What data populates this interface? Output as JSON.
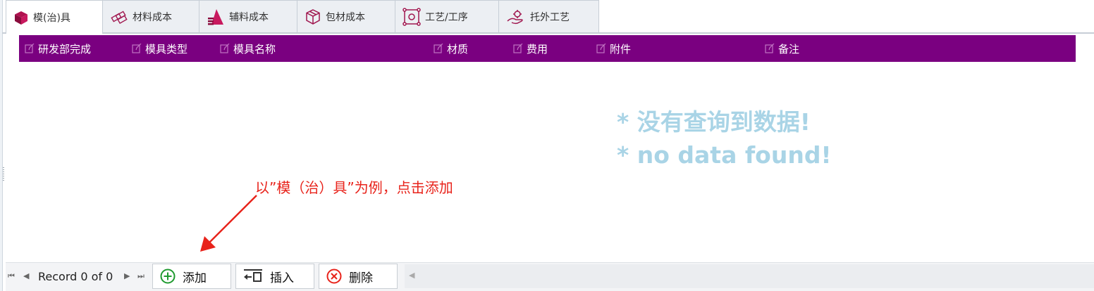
{
  "tabs": [
    {
      "label": "模(治)具",
      "icon": "cube-icon",
      "active": true
    },
    {
      "label": "材料成本",
      "icon": "materials-icon",
      "active": false
    },
    {
      "label": "辅料成本",
      "icon": "auxiliary-icon",
      "active": false
    },
    {
      "label": "包材成本",
      "icon": "package-icon",
      "active": false
    },
    {
      "label": "工艺/工序",
      "icon": "process-icon",
      "active": false
    },
    {
      "label": "托外工艺",
      "icon": "outsource-icon",
      "active": false
    }
  ],
  "grid": {
    "header_color": "#7a0080",
    "columns": [
      "研发部完成",
      "模具类型",
      "模具名称",
      "材质",
      "费用",
      "附件",
      "备注"
    ]
  },
  "empty_state": {
    "line_cn": "* 没有查询到数据!",
    "line_en": "* no data found!"
  },
  "annotation": {
    "text": "以”模（治）具”为例，点击添加",
    "color": "#e8231b"
  },
  "navigator": {
    "record_text": "Record 0 of 0",
    "add_label": "添加",
    "insert_label": "插入",
    "delete_label": "删除"
  }
}
